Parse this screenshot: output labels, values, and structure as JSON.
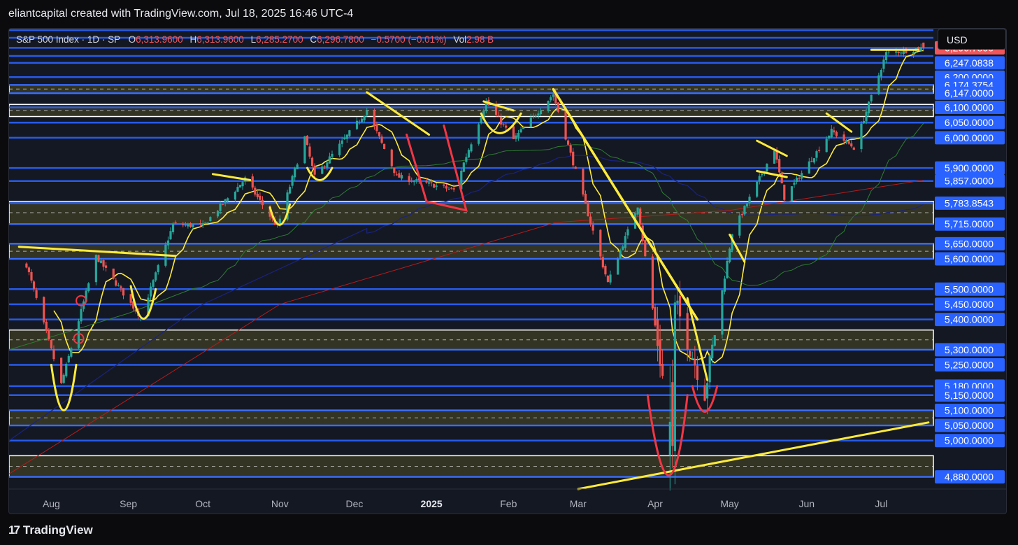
{
  "header": {
    "text": "eliantcapital created with TradingView.com, Jul 18, 2025 16:46 UTC-4"
  },
  "legend": {
    "symbol": "S&P 500 Index · 1D · SP",
    "o_label": "O",
    "o_value": "6,313.9600",
    "h_label": "H",
    "h_value": "6,313.9600",
    "l_label": "L",
    "l_value": "6,285.2700",
    "c_label": "C",
    "c_value": "6,296.7800",
    "change": "−0.5700 (−0.01%)",
    "vol_label": "Vol",
    "vol_value": "2.98 B"
  },
  "currency_button": "USD",
  "footer": {
    "logo_text": "TradingView"
  },
  "colors": {
    "up": "#26a69a",
    "down": "#ef5350",
    "level_line": "#2962ff",
    "price_label": "#2962ff",
    "last_price_label": "#f0565c",
    "zone_fill": "#3a3a24",
    "zone_border": "#ffffff",
    "annotation_yellow": "#ffeb3b",
    "annotation_red": "#f23645",
    "ma_fast": "#ffeb3b",
    "ma_mid": "#2e7d32",
    "ma_slow_red": "#b71c1c",
    "ma_slow_blue": "#1a237e"
  },
  "chart_data": {
    "type": "candlestick",
    "symbol": "S&P 500 Index",
    "interval": "1D",
    "ylim": [
      4840,
      6360
    ],
    "x_tick_labels": [
      "Aug",
      "Sep",
      "Oct",
      "Nov",
      "Dec",
      "2025",
      "Feb",
      "Mar",
      "Apr",
      "May",
      "Jun",
      "Jul"
    ],
    "price_labels": [
      {
        "text": "6,296.7800",
        "value": 6296.78,
        "kind": "last"
      },
      {
        "text": "6,247.0838",
        "value": 6247.08
      },
      {
        "text": "6,200.0000",
        "value": 6200
      },
      {
        "text": "6,174.3754",
        "value": 6174.38
      },
      {
        "text": "6,147.0000",
        "value": 6147
      },
      {
        "text": "6,100.0000",
        "value": 6100
      },
      {
        "text": "6,050.0000",
        "value": 6050
      },
      {
        "text": "6,000.0000",
        "value": 6000
      },
      {
        "text": "5,900.0000",
        "value": 5900
      },
      {
        "text": "5,857.0000",
        "value": 5857
      },
      {
        "text": "5,783.8543",
        "value": 5783.85
      },
      {
        "text": "5,715.0000",
        "value": 5715
      },
      {
        "text": "5,650.0000",
        "value": 5650
      },
      {
        "text": "5,600.0000",
        "value": 5600
      },
      {
        "text": "5,500.0000",
        "value": 5500
      },
      {
        "text": "5,450.0000",
        "value": 5450
      },
      {
        "text": "5,400.0000",
        "value": 5400
      },
      {
        "text": "5,300.0000",
        "value": 5300
      },
      {
        "text": "5,250.0000",
        "value": 5250
      },
      {
        "text": "5,180.0000",
        "value": 5180
      },
      {
        "text": "5,150.0000",
        "value": 5150
      },
      {
        "text": "5,100.0000",
        "value": 5100
      },
      {
        "text": "5,050.0000",
        "value": 5050
      },
      {
        "text": "5,000.0000",
        "value": 5000
      },
      {
        "text": "4,880.0000",
        "value": 4880
      }
    ],
    "horizontal_levels": [
      6355,
      6330,
      6296.78,
      6270,
      6247.08,
      6200,
      6174.38,
      6147,
      6100,
      6050,
      6000,
      5900,
      5857,
      5783.85,
      5715,
      5650,
      5600,
      5500,
      5450,
      5400,
      5300,
      5250,
      5180,
      5150,
      5100,
      5050,
      5000,
      4880
    ],
    "zones": [
      {
        "from": 6147,
        "to": 6174.38
      },
      {
        "from": 6070,
        "to": 6110
      },
      {
        "from": 5715,
        "to": 5790
      },
      {
        "from": 5600,
        "to": 5650
      },
      {
        "from": 5300,
        "to": 5365
      },
      {
        "from": 5050,
        "to": 5100
      },
      {
        "from": 4880,
        "to": 4950
      }
    ],
    "anchors": [
      {
        "date": "2024-07-22",
        "close": 5580
      },
      {
        "date": "2024-08-05",
        "close": 5186
      },
      {
        "date": "2024-08-19",
        "close": 5608
      },
      {
        "date": "2024-09-06",
        "close": 5408
      },
      {
        "date": "2024-09-19",
        "close": 5713
      },
      {
        "date": "2024-10-01",
        "close": 5709
      },
      {
        "date": "2024-10-18",
        "close": 5864
      },
      {
        "date": "2024-10-31",
        "close": 5705
      },
      {
        "date": "2024-11-11",
        "close": 6001
      },
      {
        "date": "2024-11-15",
        "close": 5870
      },
      {
        "date": "2024-12-06",
        "close": 6090
      },
      {
        "date": "2024-12-18",
        "close": 5872
      },
      {
        "date": "2025-01-10",
        "close": 5827
      },
      {
        "date": "2025-01-23",
        "close": 6119
      },
      {
        "date": "2025-02-03",
        "close": 5994
      },
      {
        "date": "2025-02-19",
        "close": 6144
      },
      {
        "date": "2025-03-13",
        "close": 5521
      },
      {
        "date": "2025-03-25",
        "close": 5776
      },
      {
        "date": "2025-04-08",
        "close": 4982
      },
      {
        "date": "2025-04-09",
        "close": 5456
      },
      {
        "date": "2025-04-21",
        "close": 5158
      },
      {
        "date": "2025-05-02",
        "close": 5686
      },
      {
        "date": "2025-05-19",
        "close": 5963
      },
      {
        "date": "2025-05-23",
        "close": 5802
      },
      {
        "date": "2025-06-11",
        "close": 6022
      },
      {
        "date": "2025-06-20",
        "close": 5967
      },
      {
        "date": "2025-07-03",
        "close": 6279
      },
      {
        "date": "2025-07-18",
        "close": 6296.78
      }
    ]
  }
}
